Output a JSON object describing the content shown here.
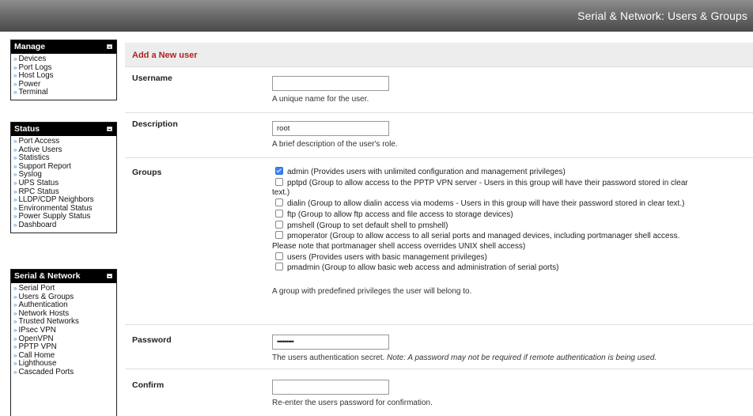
{
  "header": {
    "title": "Serial & Network: Users & Groups"
  },
  "sidebar": {
    "manage": {
      "title": "Manage",
      "items": [
        "Devices",
        "Port Logs",
        "Host Logs",
        "Power",
        "Terminal"
      ]
    },
    "status": {
      "title": "Status",
      "items": [
        "Port Access",
        "Active Users",
        "Statistics",
        "Support Report",
        "Syslog",
        "UPS Status",
        "RPC Status",
        "LLDP/CDP Neighbors",
        "Environmental Status",
        "Power Supply Status",
        "Dashboard"
      ]
    },
    "serial": {
      "title": "Serial & Network",
      "items": [
        "Serial Port",
        "Users & Groups",
        "Authentication",
        "Network Hosts",
        "Trusted Networks",
        "IPsec VPN",
        "OpenVPN",
        "PPTP VPN",
        "Call Home",
        "Lighthouse",
        "Cascaded Ports"
      ]
    }
  },
  "form": {
    "section_title": "Add a New user",
    "username": {
      "label": "Username",
      "value": "",
      "help": "A unique name for the user."
    },
    "description": {
      "label": "Description",
      "value": "root",
      "help": "A brief description of the user's role."
    },
    "groups": {
      "label": "Groups",
      "options": [
        {
          "text": "admin (Provides users with unlimited configuration and management privileges)",
          "checked": true
        },
        {
          "text": "pptpd (Group to allow access to the PPTP VPN server - Users in this group will have their password stored in clear",
          "checked": false
        },
        {
          "text": "text.)"
        },
        {
          "text": "dialin (Group to allow dialin access via modems - Users in this group will have their password stored in clear text.)",
          "checked": false
        },
        {
          "text": "ftp (Group to allow ftp access and file access to storage devices)",
          "checked": false
        },
        {
          "text": "pmshell (Group to set default shell to pmshell)",
          "checked": false
        },
        {
          "text": "pmoperator (Group to allow access to all serial ports and managed devices, including portmanager shell access.",
          "checked": false
        },
        {
          "text": "Please note that portmanager shell access overrides UNIX shell access)"
        },
        {
          "text": "users (Provides users with basic management privileges)",
          "checked": false
        },
        {
          "text": "pmadmin (Group to allow basic web access and administration of serial ports)",
          "checked": false
        }
      ],
      "help": "A group with predefined privileges the user will belong to."
    },
    "password": {
      "label": "Password",
      "value": "•••••••••",
      "help": "The users authentication secret.",
      "note": "Note: A password may not be required if remote authentication is being used."
    },
    "confirm": {
      "label": "Confirm",
      "value": "",
      "help": "Re-enter the users password for confirmation."
    }
  }
}
